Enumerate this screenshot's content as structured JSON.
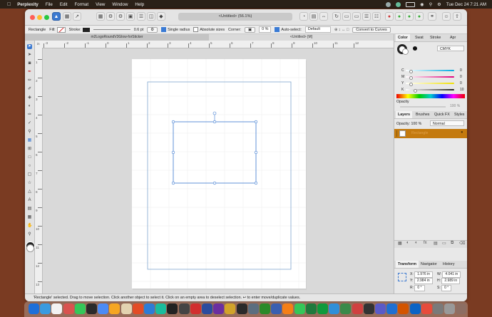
{
  "menubar": {
    "app_name": "Perplexity",
    "items": [
      "File",
      "Edit",
      "Format",
      "View",
      "Window",
      "Help"
    ],
    "clock": "Tue Dec 24  7:21 AM"
  },
  "window": {
    "doc_title": "<Untitled> (56.1%)",
    "context": {
      "tool_name": "Rectangle",
      "fill_label": "Fill:",
      "stroke_label": "Stroke:",
      "stroke_value": "0.6 pt",
      "single_radius": "Single radius",
      "absolute_sizes": "Absolute sizes",
      "corner_label": "Corner:",
      "corner_value": "0 %",
      "auto_select": "Auto-select:",
      "auto_select_value": "Default",
      "convert_button": "Convert to Curves"
    },
    "doc_tabs": [
      "m2LogoRoundV3Glow-forSticker",
      "<Untitled> [M]"
    ],
    "ruler_unit": "in",
    "hruler_labels": [
      "-3",
      "-2",
      "-1",
      "0",
      "1",
      "2",
      "3",
      "4",
      "5",
      "6",
      "7",
      "8",
      "9",
      "10",
      "11",
      "12"
    ],
    "vruler_labels": [
      "1",
      "2",
      "3",
      "4",
      "5",
      "6",
      "7",
      "8",
      "9",
      "10",
      "11",
      "12",
      "13"
    ],
    "status": "'Rectangle' selected. Drag to move selection. Click another object to select it. Click on an empty area to deselect selection. ↩ to enter move/duplicate values."
  },
  "panel": {
    "color_tabs": [
      "Color",
      "Swatches",
      "Stroke",
      "Appearance"
    ],
    "color_tabs_display": [
      "Color",
      "Swat",
      "Stroke",
      "Apr"
    ],
    "color_model": "CMYK",
    "sliders": [
      {
        "label": "C",
        "value": "0",
        "color": "#00a9e0"
      },
      {
        "label": "M",
        "value": "0",
        "color": "#e0007a"
      },
      {
        "label": "Y",
        "value": "0",
        "color": "#f0e000"
      },
      {
        "label": "K",
        "value": "10",
        "color": "#222222"
      }
    ],
    "opacity_label": "Opacity",
    "opacity_value": "100 %",
    "layers_tabs": [
      "Layers",
      "Brushes",
      "Quick FX",
      "Styles"
    ],
    "layers_opacity": "Opacity:  100 %",
    "blend_mode": "Normal",
    "layer_name": "Rectangle",
    "transform_tabs": [
      "Transform",
      "Navigator",
      "History"
    ],
    "transform": {
      "x": "1.976 in",
      "y": "2.984 in",
      "w": "4.041 in",
      "h": "2.989 in",
      "r": "0 °",
      "s": "0 °"
    }
  },
  "colors": {
    "selection": "#3a78d0",
    "layer_highlight": "#c47a0e",
    "page": "#ffffff"
  }
}
